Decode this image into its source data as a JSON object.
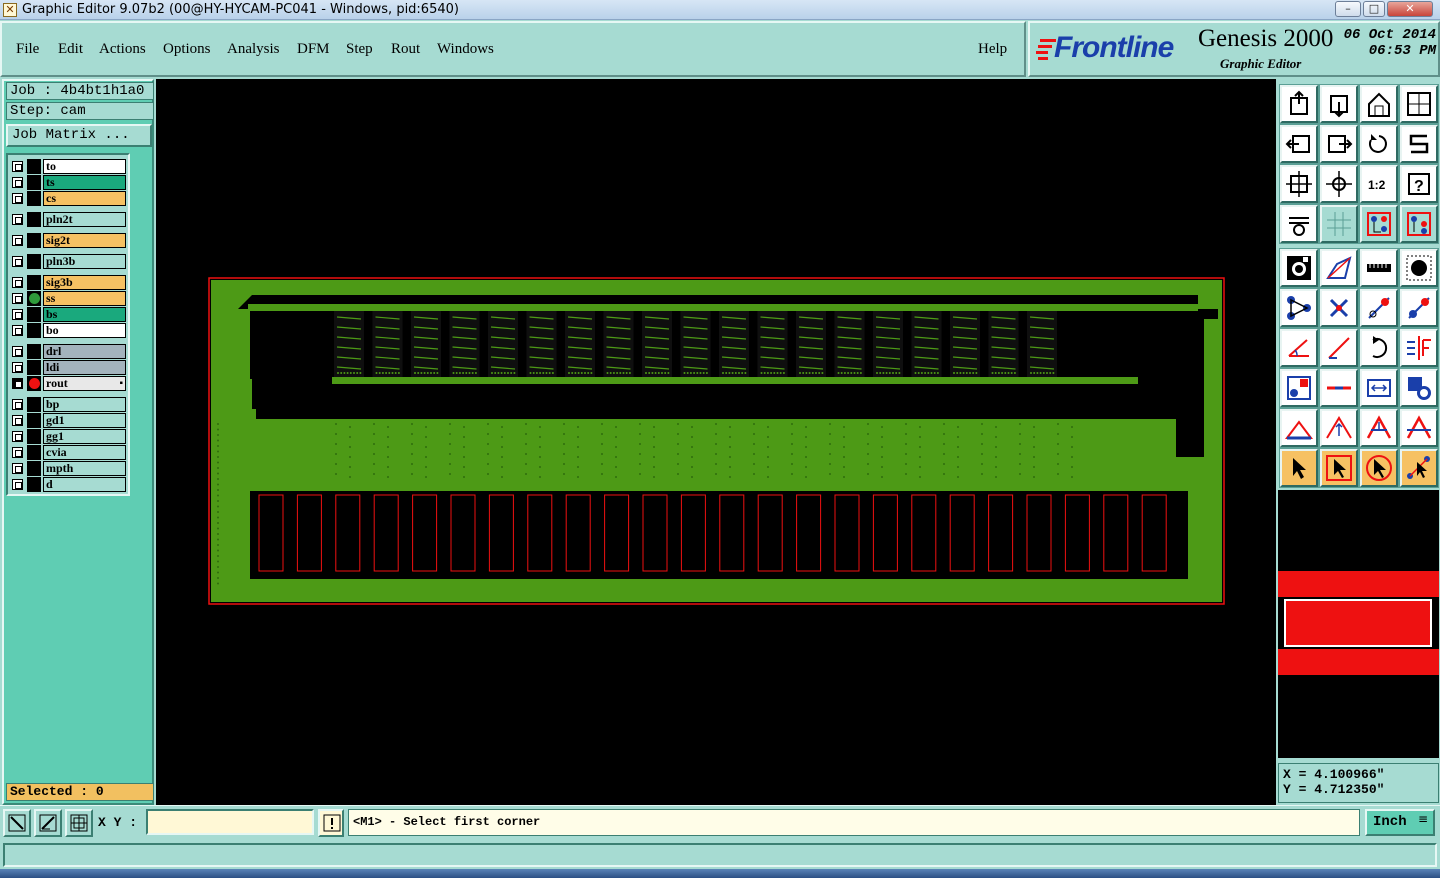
{
  "window": {
    "title": "Graphic Editor 9.07b2 (00@HY-HYCAM-PC041 - Windows, pid:6540)",
    "icon": "app-icon",
    "controls": [
      "minimize",
      "maximize",
      "close"
    ]
  },
  "menubar": {
    "items": [
      "File",
      "Edit",
      "Actions",
      "Options",
      "Analysis",
      "DFM",
      "Step",
      "Rout",
      "Windows"
    ],
    "help": "Help"
  },
  "branding": {
    "logo": "Frontline",
    "product": "Genesis 2000",
    "subtitle": "Graphic Editor",
    "date": "06 Oct 2014",
    "time": "06:53 PM"
  },
  "job": {
    "job_label": "Job : 4b4bt1h1a0",
    "step_label": "Step: cam",
    "matrix_button": "Job Matrix ..."
  },
  "layers": [
    {
      "name": "to",
      "color": "#ffffff",
      "affected": false
    },
    {
      "name": "ts",
      "color": "#1aa97d",
      "affected": false
    },
    {
      "name": "cs",
      "color": "#f6c163",
      "affected": false
    },
    {
      "name": "pln2t",
      "color": "#a6dbd2",
      "affected": false
    },
    {
      "name": "sig2t",
      "color": "#f6c163",
      "affected": false
    },
    {
      "name": "pln3b",
      "color": "#a6dbd2",
      "affected": false
    },
    {
      "name": "sig3b",
      "color": "#f6c163",
      "affected": false
    },
    {
      "name": "ss",
      "color": "#f6c163",
      "affected": true,
      "dot": "#2e9a3a"
    },
    {
      "name": "bs",
      "color": "#1aa97d",
      "affected": false
    },
    {
      "name": "bo",
      "color": "#ffffff",
      "affected": false
    },
    {
      "name": "drl",
      "color": "#a3b3bd",
      "affected": false
    },
    {
      "name": "ldi",
      "color": "#a3b3bd",
      "affected": false
    },
    {
      "name": "rout",
      "color": "#e8e8e8",
      "affected": true,
      "dot": "#ee1111",
      "work": true
    },
    {
      "name": "bp",
      "color": "#a6dbd2",
      "affected": false
    },
    {
      "name": "gd1",
      "color": "#a6dbd2",
      "affected": false
    },
    {
      "name": "gg1",
      "color": "#a6dbd2",
      "affected": false
    },
    {
      "name": "cvia",
      "color": "#a6dbd2",
      "affected": false
    },
    {
      "name": "mpth",
      "color": "#a6dbd2",
      "affected": false
    },
    {
      "name": "d",
      "color": "#a6dbd2",
      "affected": false
    }
  ],
  "selected": "Selected : 0",
  "toolbar": [
    [
      "zoom-home-icon",
      "zoom-down-icon",
      "home-icon",
      "split-view-icon"
    ],
    [
      "pan-left-icon",
      "pan-right-icon",
      "undo-zoom-icon",
      "redraw-icon"
    ],
    [
      "fit-all-icon",
      "zoom-fit-icon",
      "scale-1-2-icon",
      "help-icon"
    ],
    [
      "layer-settings-icon",
      "grid-icon",
      "layer-display-icon",
      "layer-display-alt-icon"
    ],
    [
      "select-feature-icon",
      "select-polygon-icon",
      "measure-ruler-icon",
      "pad-icon"
    ],
    [
      "connect-nodes-icon",
      "delete-node-icon",
      "add-point-icon",
      "break-point-icon"
    ],
    [
      "draw-angle-icon",
      "draw-line-icon",
      "rotate-icon",
      "mirror-icon"
    ],
    [
      "move-shape-icon",
      "horizontal-line-icon",
      "distance-icon",
      "copy-shape-icon"
    ],
    [
      "triangle-icon",
      "triangle-up-icon",
      "arch-up-icon",
      "arch-line-icon"
    ],
    [
      "pointer-icon",
      "pointer-box-icon",
      "pointer-circle-icon",
      "pointer-node-icon"
    ]
  ],
  "coords": {
    "x": "X = 4.100966\"",
    "y": "Y = 4.712350\""
  },
  "bottombar": {
    "xy_label": "X Y :",
    "xy_value": "",
    "prompt": "<M1> - Select first corner",
    "units": "Inch"
  },
  "pcb": {
    "board_color": "#4d9a16",
    "outline_color": "#e11",
    "slot_count": 24,
    "chip_count": 19
  }
}
